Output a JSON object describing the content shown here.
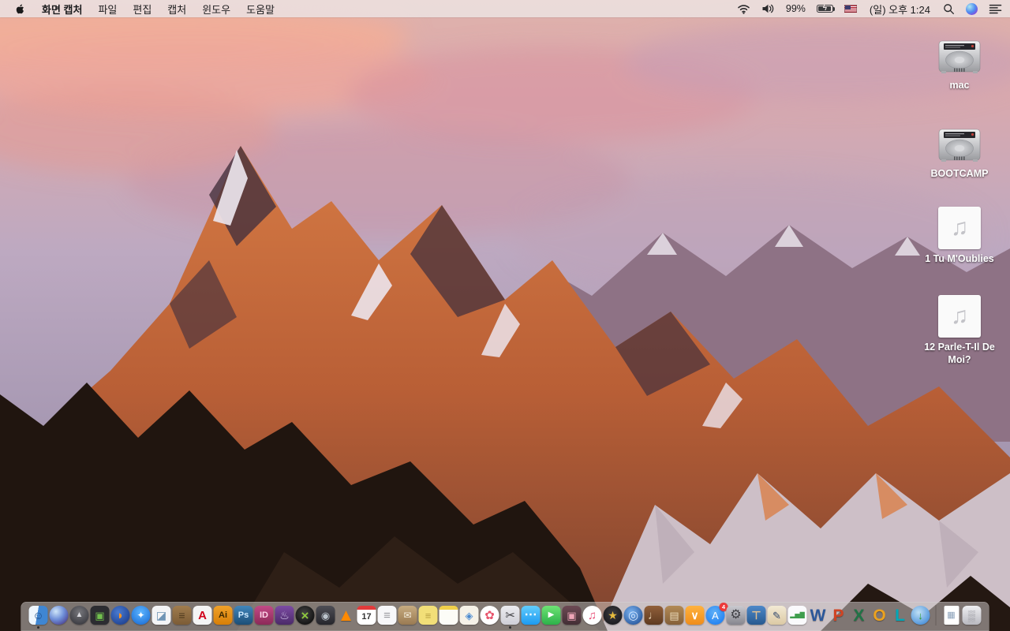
{
  "colors": {
    "menubar_bg": "#ebddDC",
    "menubar_text": "#1c1c1e",
    "dock_bg": "#cac5c2",
    "desktop_label": "#ffffff",
    "badge_red": "#ec3b3b"
  },
  "menu_bar": {
    "apple_icon": "apple-logo-icon",
    "app_name": "화면 캡처",
    "menus": [
      "파일",
      "편집",
      "캡처",
      "윈도우",
      "도움말"
    ],
    "status": {
      "icons": [
        "wifi-icon",
        "volume-icon",
        "battery-charging-icon",
        "us-flag-input-source-icon",
        "spotlight-search-icon",
        "siri-icon",
        "notification-center-icon"
      ],
      "battery_percent": "99%",
      "clock": "(일) 오후 1:24"
    }
  },
  "desktop": {
    "icons": [
      {
        "name": "drive-mac",
        "type": "hard-drive",
        "icon": "hard-drive-icon",
        "label": "mac"
      },
      {
        "name": "drive-bootcamp",
        "type": "hard-drive",
        "icon": "hard-drive-icon",
        "label": "BOOTCAMP"
      },
      {
        "name": "audio-file-1",
        "type": "audio-file",
        "icon": "music-note-icon",
        "glyph": "♫",
        "label": "1 Tu M'Oublies"
      },
      {
        "name": "audio-file-12",
        "type": "audio-file",
        "icon": "music-note-icon",
        "glyph": "♫",
        "label": "12 Parle-T-Il De Moi?"
      }
    ]
  },
  "dock": {
    "items": [
      {
        "name": "finder",
        "glyph": "☺",
        "shape": "rounded",
        "bg": "linear-gradient(100deg,#eef6fd 45%,#3f86d2 45%)",
        "fg": "#1d4e89",
        "fs": 14,
        "running": true
      },
      {
        "name": "siri",
        "glyph": "",
        "shape": "circle",
        "bg": "radial-gradient(circle at 35% 30%,#cfe6f8,#6f8fd8 45%,#4a3f8f 85%)",
        "fg": "#ffffff"
      },
      {
        "name": "launchpad",
        "glyph": "▲",
        "shape": "circle",
        "bg": "radial-gradient(circle at 50% 35%,#77777c,#3c3c42 80%)",
        "fg": "#d9d9de",
        "fs": 10
      },
      {
        "name": "mission-control",
        "glyph": "▣",
        "shape": "rounded",
        "bg": "#2c2c31",
        "fg": "#72c04e",
        "fs": 13
      },
      {
        "name": "firefox",
        "glyph": "◗",
        "shape": "circle",
        "bg": "radial-gradient(circle at 40% 35%,#4a7bd0,#1d3f8f 85%)",
        "fg": "#ff9522",
        "fs": 15
      },
      {
        "name": "safari",
        "glyph": "✦",
        "shape": "circle",
        "bg": "radial-gradient(circle at 50% 35%,#5db5ff,#1f72d8 85%)",
        "fg": "#ffffff",
        "fs": 12
      },
      {
        "name": "preview",
        "glyph": "◪",
        "shape": "rounded",
        "bg": "#f4f4f6",
        "fg": "#6f94b5",
        "fs": 14
      },
      {
        "name": "contacts-book",
        "glyph": "≡",
        "shape": "rounded",
        "bg": "linear-gradient(#a07c4e,#7c5c36)",
        "fg": "#513c1f",
        "fs": 14
      },
      {
        "name": "acrobat-reader",
        "glyph": "A",
        "shape": "rounded",
        "bg": "#f4f4f4",
        "fg": "#d0021b",
        "fs": 15,
        "bold": true
      },
      {
        "name": "illustrator",
        "glyph": "Ai",
        "shape": "rounded",
        "bg": "linear-gradient(#f0a12a,#d87f07)",
        "fg": "#3b2800",
        "fs": 11,
        "bold": true
      },
      {
        "name": "photoshop",
        "glyph": "Ps",
        "shape": "rounded",
        "bg": "linear-gradient(#4186bb,#1c4e77)",
        "fg": "#cfeaff",
        "fs": 11,
        "bold": true
      },
      {
        "name": "indesign",
        "glyph": "ID",
        "shape": "rounded",
        "bg": "linear-gradient(#c24a86,#8c2a58)",
        "fg": "#ffd7ea",
        "fs": 11,
        "bold": true
      },
      {
        "name": "toast-burner",
        "glyph": "♨",
        "shape": "rounded",
        "bg": "linear-gradient(#7c4ba3,#4b2a69)",
        "fg": "#d9c9ef",
        "fs": 14
      },
      {
        "name": "x-media-converter",
        "glyph": "×",
        "shape": "circle",
        "bg": "radial-gradient(circle at 45% 40%,#454545,#0c0c0c 85%)",
        "fg": "#8dc63f",
        "fs": 17,
        "bold": true
      },
      {
        "name": "disk-tool",
        "glyph": "◉",
        "shape": "rounded",
        "bg": "linear-gradient(#4e4e55,#26262c)",
        "fg": "#bcc4cc",
        "fs": 13
      },
      {
        "name": "vlc",
        "glyph": "▲",
        "shape": "none",
        "bg": "transparent",
        "fg": "#ff8a00",
        "fs": 22
      },
      {
        "name": "calendar",
        "glyph": "17",
        "shape": "rounded",
        "bg": "#ffffff",
        "fg": "#333333",
        "fs": 11,
        "bold": true,
        "stripe": "#e23b3b"
      },
      {
        "name": "reminders",
        "glyph": "≡",
        "shape": "rounded",
        "bg": "#f7f7f9",
        "fg": "#9a9aa0",
        "fs": 15
      },
      {
        "name": "mail-drop-box",
        "glyph": "✉",
        "shape": "rounded",
        "bg": "linear-gradient(#c7ab80,#997a52)",
        "fg": "#f4eedd",
        "fs": 12
      },
      {
        "name": "stickies",
        "glyph": "≡",
        "shape": "rounded",
        "bg": "#f2df78",
        "fg": "#b9a242",
        "fs": 13
      },
      {
        "name": "notepad",
        "glyph": "",
        "shape": "rounded",
        "bg": "#fcfcf7",
        "fg": "#999999",
        "stripe": "#f0cf4a"
      },
      {
        "name": "page-layout-docs",
        "glyph": "◈",
        "shape": "rounded",
        "bg": "#f6f2e8",
        "fg": "#4a8ad0",
        "fs": 13
      },
      {
        "name": "photos",
        "glyph": "✿",
        "shape": "circle",
        "bg": "#ffffff",
        "fg": "#e8566d",
        "fs": 15
      },
      {
        "name": "grab-screen-capture",
        "glyph": "✂",
        "shape": "rounded",
        "bg": "linear-gradient(#ececf0,#cfcfd6)",
        "fg": "#3c3c40",
        "fs": 15,
        "running": true
      },
      {
        "name": "messages",
        "glyph": "⋯",
        "shape": "rounded",
        "bg": "linear-gradient(#62cdfd,#1d9af0)",
        "fg": "#ffffff",
        "fs": 16,
        "bold": true
      },
      {
        "name": "facetime",
        "glyph": "▶",
        "shape": "rounded",
        "bg": "linear-gradient(#6ee374,#2cb14a)",
        "fg": "#ffffff",
        "fs": 10
      },
      {
        "name": "photo-booth",
        "glyph": "▣",
        "shape": "rounded",
        "bg": "linear-gradient(#6d4a54,#432e35)",
        "fg": "#efa6b8",
        "fs": 13
      },
      {
        "name": "itunes",
        "glyph": "♫",
        "shape": "circle",
        "bg": "#ffffff",
        "fg": "#e94f77",
        "fs": 15
      },
      {
        "name": "imovie",
        "glyph": "★",
        "shape": "circle",
        "bg": "radial-gradient(circle at 50% 40%,#3d3d42,#18181c 85%)",
        "fg": "#e5bb3e",
        "fs": 14
      },
      {
        "name": "idvd",
        "glyph": "◎",
        "shape": "circle",
        "bg": "radial-gradient(circle at 40% 35%,#7ab2ef,#24549a 85%)",
        "fg": "#d6e8ff",
        "fs": 15
      },
      {
        "name": "garageband",
        "glyph": "♩",
        "shape": "rounded",
        "bg": "linear-gradient(#91603a,#5e3a20)",
        "fg": "#ecd6b5",
        "fs": 15
      },
      {
        "name": "project-corkboard",
        "glyph": "▤",
        "shape": "rounded",
        "bg": "linear-gradient(#b28a55,#84603a)",
        "fg": "#ecdcbc",
        "fs": 13
      },
      {
        "name": "ibooks",
        "glyph": "∨",
        "shape": "rounded",
        "bg": "linear-gradient(#ffb23e,#ef8d1a)",
        "fg": "#ffffff",
        "fs": 14,
        "bold": true
      },
      {
        "name": "app-store",
        "glyph": "A",
        "shape": "circle",
        "bg": "radial-gradient(circle at 45% 35%,#5fb0f7,#1d7ef2 85%)",
        "fg": "#ffffff",
        "fs": 13,
        "badge": "4"
      },
      {
        "name": "system-preferences",
        "glyph": "⚙",
        "shape": "rounded",
        "bg": "linear-gradient(#c9c9cf,#86868e)",
        "fg": "#3f3f45",
        "fs": 16
      },
      {
        "name": "keynote",
        "glyph": "⊤",
        "shape": "rounded",
        "bg": "linear-gradient(#4c88c8,#28598f)",
        "fg": "#e2c091",
        "fs": 14,
        "bold": true
      },
      {
        "name": "pages",
        "glyph": "✎",
        "shape": "rounded",
        "bg": "linear-gradient(#f2ead4,#dcc9a4)",
        "fg": "#31486e",
        "fs": 13
      },
      {
        "name": "numbers",
        "glyph": "▂▅▇",
        "shape": "rounded",
        "bg": "#fafafc",
        "fg": "#3f9e4d",
        "fs": 8
      },
      {
        "name": "ms-word",
        "glyph": "W",
        "shape": "none",
        "bg": "transparent",
        "fg": "#2b579a",
        "fs": 21,
        "bold": true
      },
      {
        "name": "ms-powerpoint",
        "glyph": "P",
        "shape": "none",
        "bg": "transparent",
        "fg": "#d04423",
        "fs": 21,
        "bold": true
      },
      {
        "name": "ms-excel",
        "glyph": "X",
        "shape": "none",
        "bg": "transparent",
        "fg": "#217346",
        "fs": 21,
        "bold": true
      },
      {
        "name": "ms-outlook",
        "glyph": "O",
        "shape": "none",
        "bg": "transparent",
        "fg": "#eba21f",
        "fs": 21,
        "bold": true
      },
      {
        "name": "ms-lync",
        "glyph": "L",
        "shape": "none",
        "bg": "transparent",
        "fg": "#00a8b8",
        "fs": 21,
        "bold": true
      },
      {
        "name": "ms-document-connection",
        "glyph": "↓",
        "shape": "circle",
        "bg": "radial-gradient(circle at 40% 35%,#bfe0f5,#4a90d9 80%)",
        "fg": "#2f9e2f",
        "fs": 13,
        "bold": true
      },
      {
        "name": "dock-divider",
        "type": "divider"
      },
      {
        "name": "screenshot-document",
        "glyph": "▦",
        "shape": "page",
        "bg": "#ffffff",
        "fg": "#8aa0b8",
        "fs": 11
      },
      {
        "name": "trash-full",
        "glyph": "▒",
        "shape": "rounded",
        "bg": "linear-gradient(#efeff2,#b9b9c0)",
        "fg": "#8f8f96",
        "fs": 13
      }
    ]
  }
}
